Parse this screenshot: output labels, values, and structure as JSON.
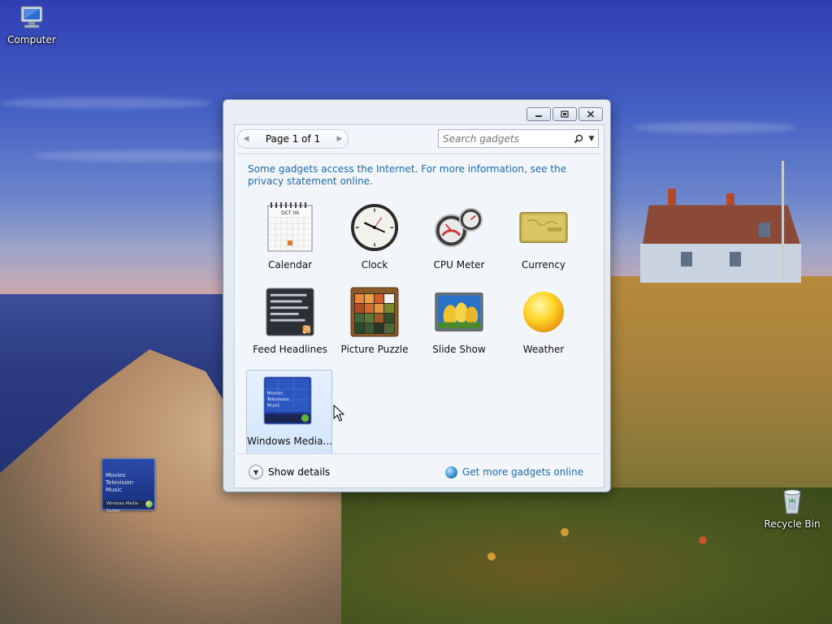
{
  "desktop": {
    "icons": {
      "computer": "Computer",
      "recycle_bin": "Recycle Bin"
    },
    "mini_media_widget": {
      "lines": [
        "Movies",
        "Television",
        "Music"
      ],
      "bar_label": "Windows Media Center"
    }
  },
  "gallery": {
    "pager": {
      "label": "Page 1 of 1"
    },
    "search": {
      "placeholder": "Search gadgets"
    },
    "info_text": "Some gadgets access the Internet.  For more information, see the privacy statement online.",
    "gadgets": [
      {
        "label": "Calendar",
        "icon": "calendar-icon"
      },
      {
        "label": "Clock",
        "icon": "clock-icon"
      },
      {
        "label": "CPU Meter",
        "icon": "cpu-meter-icon"
      },
      {
        "label": "Currency",
        "icon": "currency-icon"
      },
      {
        "label": "Feed Headlines",
        "icon": "feed-headlines-icon"
      },
      {
        "label": "Picture Puzzle",
        "icon": "picture-puzzle-icon"
      },
      {
        "label": "Slide Show",
        "icon": "slide-show-icon"
      },
      {
        "label": "Weather",
        "icon": "weather-icon"
      },
      {
        "label": "Windows Media...",
        "icon": "windows-media-center-icon",
        "selected": true
      }
    ],
    "calendar_month": "OCT 06",
    "footer": {
      "show_details": "Show details",
      "get_more": "Get more gadgets online"
    }
  },
  "colors": {
    "link": "#1d6ab5",
    "selection": "#d4e6fb"
  }
}
